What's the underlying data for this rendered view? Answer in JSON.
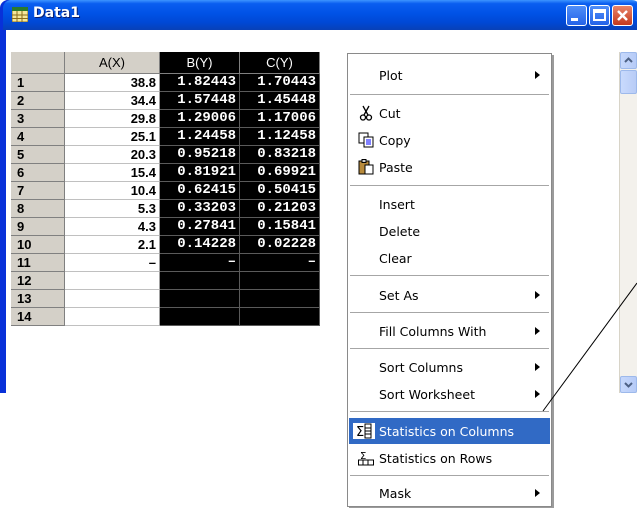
{
  "window": {
    "title": "Data1"
  },
  "worksheet": {
    "columns": [
      "A(X)",
      "B(Y)",
      "C(Y)"
    ],
    "rows": [
      {
        "row": "1",
        "a": "38.8",
        "b": "1.82443",
        "c": "1.70443"
      },
      {
        "row": "2",
        "a": "34.4",
        "b": "1.57448",
        "c": "1.45448"
      },
      {
        "row": "3",
        "a": "29.8",
        "b": "1.29006",
        "c": "1.17006"
      },
      {
        "row": "4",
        "a": "25.1",
        "b": "1.24458",
        "c": "1.12458"
      },
      {
        "row": "5",
        "a": "20.3",
        "b": "0.95218",
        "c": "0.83218"
      },
      {
        "row": "6",
        "a": "15.4",
        "b": "0.81921",
        "c": "0.69921"
      },
      {
        "row": "7",
        "a": "10.4",
        "b": "0.62415",
        "c": "0.50415"
      },
      {
        "row": "8",
        "a": "5.3",
        "b": "0.33203",
        "c": "0.21203"
      },
      {
        "row": "9",
        "a": "4.3",
        "b": "0.27841",
        "c": "0.15841"
      },
      {
        "row": "10",
        "a": "2.1",
        "b": "0.14228",
        "c": "0.02228"
      },
      {
        "row": "11",
        "a": "–",
        "b": "–",
        "c": "–"
      },
      {
        "row": "12",
        "a": "",
        "b": "",
        "c": ""
      },
      {
        "row": "13",
        "a": "",
        "b": "",
        "c": ""
      },
      {
        "row": "14",
        "a": "",
        "b": "",
        "c": ""
      }
    ]
  },
  "context_menu": {
    "plot": "Plot",
    "cut": "Cut",
    "copy": "Copy",
    "paste": "Paste",
    "insert": "Insert",
    "delete": "Delete",
    "clear": "Clear",
    "set_as": "Set As",
    "fill_columns_with": "Fill Columns With",
    "sort_columns": "Sort Columns",
    "sort_worksheet": "Sort Worksheet",
    "statistics_on_columns": "Statistics on Columns",
    "statistics_on_rows": "Statistics on Rows",
    "mask": "Mask"
  },
  "colors": {
    "title_bar": "#0a5ef0",
    "selection": "#000000",
    "menu_highlight": "#316ac5"
  }
}
